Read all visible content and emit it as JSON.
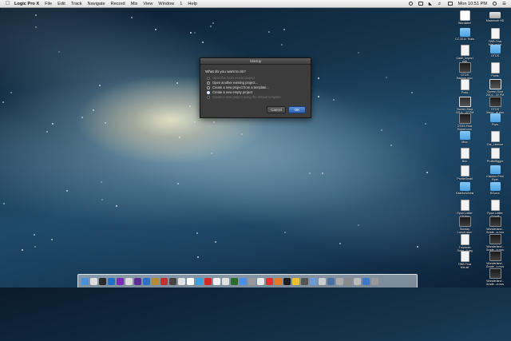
{
  "menubar": {
    "app_name": "Logic Pro X",
    "items": [
      "File",
      "Edit",
      "Track",
      "Navigate",
      "Record",
      "Mix",
      "View",
      "Window",
      "1",
      "Help"
    ],
    "clock": "Mon 10:51 PM"
  },
  "dialog": {
    "title": "Startup",
    "question": "What do you want to do?",
    "options": [
      {
        "label": "Open the most recent project",
        "enabled": false,
        "selected": false
      },
      {
        "label": "Open another existing project...",
        "enabled": true,
        "selected": false
      },
      {
        "label": "Create a new project from a template...",
        "enabled": true,
        "selected": false
      },
      {
        "label": "Create a new empty project",
        "enabled": true,
        "selected": true
      },
      {
        "label": "Create a new project using the default template",
        "enabled": false,
        "selected": false
      }
    ],
    "cancel_label": "Cancel",
    "ok_label": "OK"
  },
  "desktop_icons": [
    {
      "label": "Macintosh HD",
      "kind": "disk"
    },
    {
      "label": "Wordlabel",
      "kind": "app"
    },
    {
      "label": "EWB Final\nMixLog.txt",
      "kind": "doc"
    },
    {
      "label": "CC 2014 Trials",
      "kind": "folder"
    },
    {
      "label": "OTDS",
      "kind": "folder"
    },
    {
      "label": "Garth_Import\nedit",
      "kind": "doc"
    },
    {
      "label": "Pants",
      "kind": "doc"
    },
    {
      "label": "OTDS\nBackup.mov",
      "kind": "movie"
    },
    {
      "label": "Screen Shot\n2014-...22 PM",
      "kind": "shot"
    },
    {
      "label": "Pods",
      "kind": "doc"
    },
    {
      "label": "OTDS\nDirect...al.mov",
      "kind": "movie"
    },
    {
      "label": "Screen Shot\n2014-...22 PM",
      "kind": "shot"
    },
    {
      "label": "Pops",
      "kind": "folder"
    },
    {
      "label": "OTDS Final\nExport.mov",
      "kind": "movie"
    },
    {
      "label": "Car_License",
      "kind": "doc"
    },
    {
      "label": "Misc",
      "kind": "folder"
    },
    {
      "label": "ProfileBiggie",
      "kind": "doc"
    },
    {
      "label": "Box",
      "kind": "doc"
    },
    {
      "label": "Kisimbo Print\nFlyer",
      "kind": "folder"
    },
    {
      "label": "ProfileSmall",
      "kind": "doc"
    },
    {
      "label": "BSurce",
      "kind": "folder"
    },
    {
      "label": "KisimboWebsi",
      "kind": "folder"
    },
    {
      "label": "Ryan Lottier\nCV.pdf",
      "kind": "doc"
    },
    {
      "label": "Ryan Lottier\nCV.doc",
      "kind": "doc"
    },
    {
      "label": "Wonderland -\nGrade...a.mov",
      "kind": "movie"
    },
    {
      "label": "Sunday\nLunch.mov",
      "kind": "movie"
    },
    {
      "label": "Wonderland -\nGrade...b.mov",
      "kind": "movie"
    },
    {
      "label": "Tropicola\nSoho...0.jpg",
      "kind": "doc"
    },
    {
      "label": "Wonderland -\nGrade...c.mov",
      "kind": "movie"
    },
    {
      "label": "EWB Final\nMix.aif",
      "kind": "doc"
    },
    {
      "label": "Wonderland -\nGrade...d.mov",
      "kind": "movie"
    }
  ],
  "dock_colors": [
    "#4a90d9",
    "#ddd",
    "#2a2a2a",
    "#1f6fc6",
    "#7a2bb5",
    "#d9d9d9",
    "#5c2d91",
    "#2f6ecf",
    "#b58a32",
    "#c42f2f",
    "#444",
    "#e2e2e2",
    "#fff",
    "#3aa0e0",
    "#d02a2a",
    "#f0f0f0",
    "#e0e0e0",
    "#2d6a2d",
    "#4b8ee8",
    "#999",
    "#e8e8e8",
    "#d33",
    "#e07b2a",
    "#1d1d1d",
    "#f0c030",
    "#555",
    "#6a9bd8",
    "#ccc",
    "#4a6fa5",
    "#aaa",
    "#8a8a8a",
    "#bbb",
    "#3c78c8",
    "#999"
  ]
}
